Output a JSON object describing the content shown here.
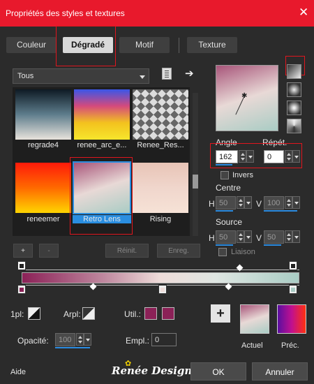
{
  "window": {
    "title": "Propriétés des styles et textures"
  },
  "tabs": [
    {
      "label": "Couleur",
      "active": false
    },
    {
      "label": "Dégradé",
      "active": true
    },
    {
      "label": "Motif",
      "active": false
    },
    {
      "label": "Texture",
      "active": false
    }
  ],
  "library": {
    "category": "Tous",
    "gradients": [
      {
        "label": "regrade4",
        "colors": [
          "#0e1a24",
          "#5e7d8c",
          "#e8e3dc"
        ],
        "selected": false
      },
      {
        "label": "renee_arc_e...",
        "colors": [
          "#3a56e8",
          "#d54a7c",
          "#f3c21e",
          "#f6e62c"
        ],
        "selected": false
      },
      {
        "label": "Renee_Res...",
        "colors": [
          "#1a1a1a",
          "#7a7a7a",
          "#f0f0f0"
        ],
        "selected": false
      },
      {
        "label": "reneemer",
        "colors": [
          "#ff1a0a",
          "#ff6a00",
          "#ffd500"
        ],
        "selected": false
      },
      {
        "label": "Retro Lens",
        "colors": [
          "#a8557a",
          "#e8d9d6",
          "#a9ccc4"
        ],
        "selected": true
      },
      {
        "label": "Rising",
        "colors": [
          "#e8c4b6",
          "#f0d6cc",
          "#f6e2d6"
        ],
        "selected": false
      }
    ]
  },
  "buttons": {
    "add": "+",
    "remove": "-",
    "reset": "Réinit.",
    "save": "Enreg."
  },
  "settings": {
    "angle_label": "Angle",
    "angle": "162",
    "repeat_label": "Répét.",
    "repeat": "0",
    "invert_label": "Invers",
    "center_label": "Centre",
    "center_h_label": "H",
    "center_h": "50",
    "center_v_label": "V",
    "center_v": "100",
    "source_label": "Source",
    "source_h_label": "H",
    "source_h": "50",
    "source_v_label": "V",
    "source_v": "50",
    "link_label": "Liaison"
  },
  "stops": {
    "one_pl_label": "1pl:",
    "arpl_label": "Arpl:",
    "util_label": "Util.:",
    "util_color": "#8b2157",
    "opacity_label": "Opacité:",
    "opacity": "100",
    "empl_label": "Empl.:",
    "empl": "0"
  },
  "preview": {
    "current_label": "Actuel",
    "previous_label": "Préc."
  },
  "footer": {
    "help": "Aide",
    "logo": "Renée Design",
    "ok": "OK",
    "cancel": "Annuler"
  },
  "colors": {
    "titlebar": "#e8192c",
    "accent": "#2b8be0",
    "highlight": "#e0161e"
  }
}
